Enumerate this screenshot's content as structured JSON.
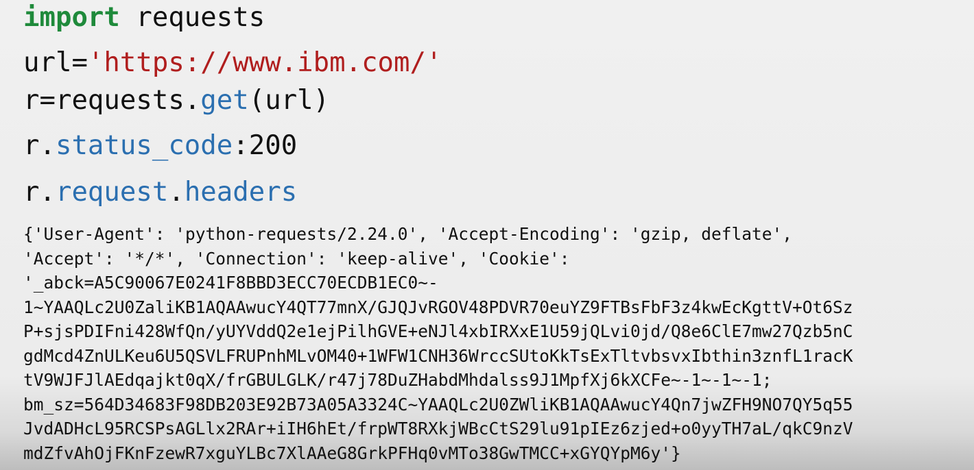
{
  "code": {
    "line1": {
      "keyword": "import",
      "rest": " requests"
    },
    "line2": {
      "prefix": "url=",
      "string": "'https://www.ibm.com/'"
    },
    "line3": {
      "prefix": "r=requests.",
      "method": "get",
      "suffix": "(url)"
    },
    "line4": {
      "prefix": "r.",
      "attr": "status_code",
      "suffix": ":200"
    },
    "line5": {
      "prefix": "r.",
      "attr1": "request",
      "dot": ".",
      "attr2": "headers"
    }
  },
  "output": {
    "lines": [
      "{'User-Agent': 'python-requests/2.24.0', 'Accept-Encoding': 'gzip, deflate',",
      "'Accept': '*/*', 'Connection': 'keep-alive', 'Cookie':",
      "'_abck=A5C90067E0241F8BBD3ECC70ECDB1EC0~-",
      "1~YAAQLc2U0ZaliKB1AQAAwucY4QT77mnX/GJQJvRGOV48PDVR70euYZ9FTBsFbF3z4kwEcKgttV+Ot6Sz",
      "P+sjsPDIFni428WfQn/yUYVddQ2e1ejPilhGVE+eNJl4xbIRXxE1U59jQLvi0jd/Q8e6ClE7mw27Qzb5nC",
      "gdMcd4ZnULKeu6U5QSVLFRUPnhMLvOM40+1WFW1CNH36WrccSUtoKkTsExTltvbsvxIbthin3znfL1racK",
      "tV9WJFJlAEdqajkt0qX/frGBULGLK/r47j78DuZHabdMhdalss9J1MpfXj6kXCFe~-1~-1~-1;",
      "bm_sz=564D34683F98DB203E92B73A05A3324C~YAAQLc2U0ZWliKB1AQAAwucY4Qn7jwZFH9NO7QY5q55",
      "JvdADHcL95RCSPsAGLlx2RAr+iIH6hEt/frpWT8RXkjWBcCtS29lu91pIEz6zjed+o0yyTH7aL/qkC9nzV",
      "mdZfvAhOjFKnFzewR7xguYLBc7XlAAeG8GrkPFHq0vMTo38GwTMCC+xGYQYpM6y'}"
    ]
  }
}
